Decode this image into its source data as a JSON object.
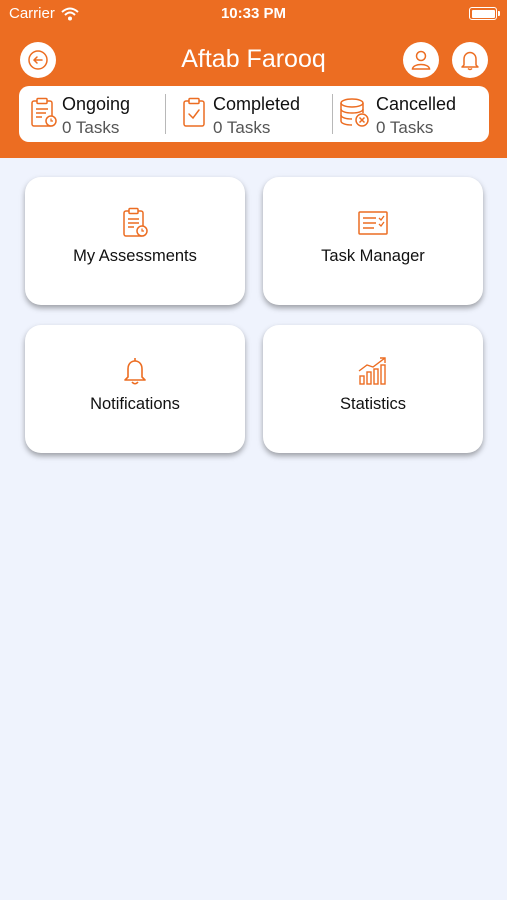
{
  "status_bar": {
    "carrier": "Carrier",
    "time": "10:33 PM"
  },
  "header": {
    "title": "Aftab Farooq"
  },
  "summary": [
    {
      "label": "Ongoing",
      "count": "0 Tasks",
      "icon": "clipboard-clock-icon"
    },
    {
      "label": "Completed",
      "count": "0 Tasks",
      "icon": "clipboard-check-icon"
    },
    {
      "label": "Cancelled",
      "count": "0 Tasks",
      "icon": "database-cancel-icon"
    }
  ],
  "menu": [
    {
      "label": "My Assessments",
      "icon": "assessment-icon"
    },
    {
      "label": "Task Manager",
      "icon": "task-list-icon"
    },
    {
      "label": "Notifications",
      "icon": "bell-icon"
    },
    {
      "label": "Statistics",
      "icon": "chart-icon"
    }
  ],
  "colors": {
    "accent": "#ec6d22",
    "background": "#eff3fd",
    "card": "#ffffff"
  }
}
